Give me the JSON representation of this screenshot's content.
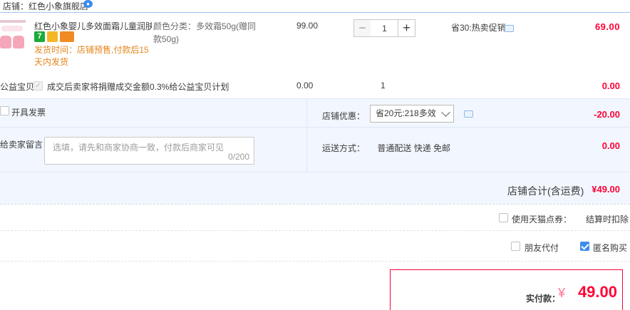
{
  "shop": {
    "label": "店铺：红色小象旗舰店"
  },
  "item": {
    "title": "红色小象婴儿多效面霜儿童润肤...",
    "badge_7": "7",
    "ship_note": "发货时间：店铺预售,付款后15天内发货",
    "sku": "颜色分类：多效霜50g(赠同款50g)",
    "price": "99.00",
    "quantity": "1",
    "promo": "省30:热卖促销",
    "subtotal": "69.00"
  },
  "charity": {
    "label": "公益宝贝",
    "text": "成交后卖家将捐赠成交金额0.3%给公益宝贝计划",
    "price": "0.00",
    "qty": "1",
    "subtotal": "0.00"
  },
  "invoice": {
    "label": "开具发票"
  },
  "discount": {
    "label": "店铺优惠：",
    "selected": "省20元:218多效",
    "value": "-20.00"
  },
  "message": {
    "label": "给卖家留言：",
    "placeholder": "选填，请先和商家协商一致，付款后商家可见",
    "count": "0/200"
  },
  "shipping": {
    "label": "运送方式：",
    "method": "普通配送 快递 免邮",
    "value": "0.00"
  },
  "shop_total": {
    "label": "店铺合计(含运费)",
    "value": "¥49.00"
  },
  "tmall_points": {
    "label": "使用天猫点券：",
    "value": "结算时扣除"
  },
  "options": {
    "friend_pay": "朋友代付",
    "anonymous": "匿名购买"
  },
  "payment": {
    "label": "实付款：",
    "currency": "¥",
    "amount": "49.00"
  },
  "icons": {
    "qty_minus": "−",
    "qty_plus": "+",
    "checkmark": "✓"
  },
  "colors": {
    "accent_red": "#ff0036",
    "link_blue": "#3c8cee",
    "promo_orange": "#e5851c",
    "panel_blue": "#f2f7ff"
  }
}
